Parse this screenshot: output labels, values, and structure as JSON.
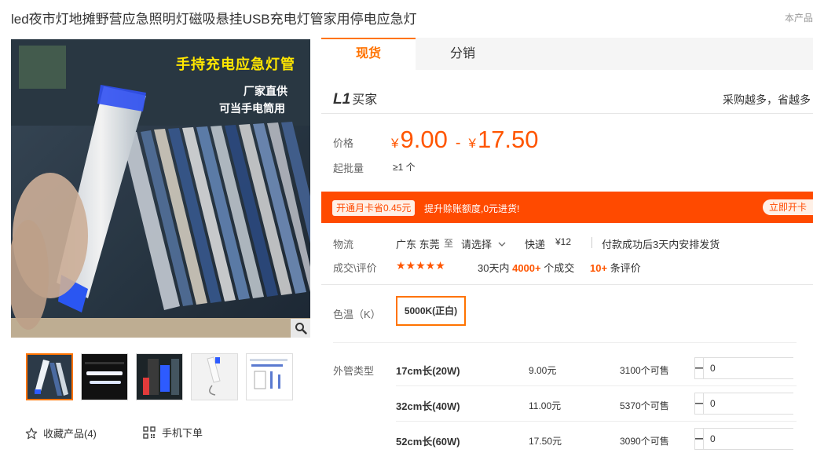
{
  "product": {
    "title": "led夜市灯地摊野营应急照明灯磁吸悬挂USB充电灯管家用停电应急灯",
    "title_right": "本产品"
  },
  "gallery": {
    "main_texts": [
      "手持充电应急灯管",
      "厂家直供",
      "可当手电筒用"
    ],
    "thumb_count": 5,
    "active_index": 0
  },
  "actions": {
    "favorite_label": "收藏产品(4)",
    "mobile_label": "手机下单"
  },
  "tabs": [
    {
      "label": "现货",
      "active": true
    },
    {
      "label": "分销",
      "active": false
    }
  ],
  "buyer": {
    "badge": "L1",
    "label": "买家",
    "slogan": "采购越多，省越多"
  },
  "price": {
    "label": "价格",
    "currency": "¥",
    "low": "9.00",
    "separator": "-",
    "high": "17.50",
    "moq_label": "起批量",
    "moq_value": "≥1 个"
  },
  "promo": {
    "badge": "开通月卡省0.45元",
    "text": "提升赊账额度,0元进货!",
    "button": "立即开卡"
  },
  "logistics": {
    "label": "物流",
    "origin": "广东 东莞",
    "to": "至",
    "select_placeholder": "请选择",
    "express": "快递",
    "fee": "¥12",
    "ship_note": "付款成功后3天内安排发货"
  },
  "deals": {
    "label": "成交\\评价",
    "stars": "★★★★★",
    "deal_prefix": "30天内",
    "deal_count": "4000+",
    "deal_suffix": "个成交",
    "review_count": "10+",
    "review_suffix": "条评价"
  },
  "color_temp": {
    "label": "色温（K）",
    "option": "5000K(正白)"
  },
  "variants": {
    "label": "外管类型",
    "rows": [
      {
        "name": "17cm长(20W)",
        "price": "9.00元",
        "stock": "3100个可售",
        "qty": "0"
      },
      {
        "name": "32cm长(40W)",
        "price": "11.00元",
        "stock": "5370个可售",
        "qty": "0"
      },
      {
        "name": "52cm长(60W)",
        "price": "17.50元",
        "stock": "3090个可售",
        "qty": "0"
      }
    ]
  },
  "colors": {
    "accent": "#ff7300",
    "price": "#ff5500",
    "promo_bg": "#ff4a00"
  },
  "icons": {
    "zoom": "magnifier-icon",
    "favorite": "star-outline-icon",
    "mobile": "qr-code-icon",
    "dropdown": "chevron-down-icon",
    "minus": "minus-icon",
    "plus": "plus-icon"
  }
}
